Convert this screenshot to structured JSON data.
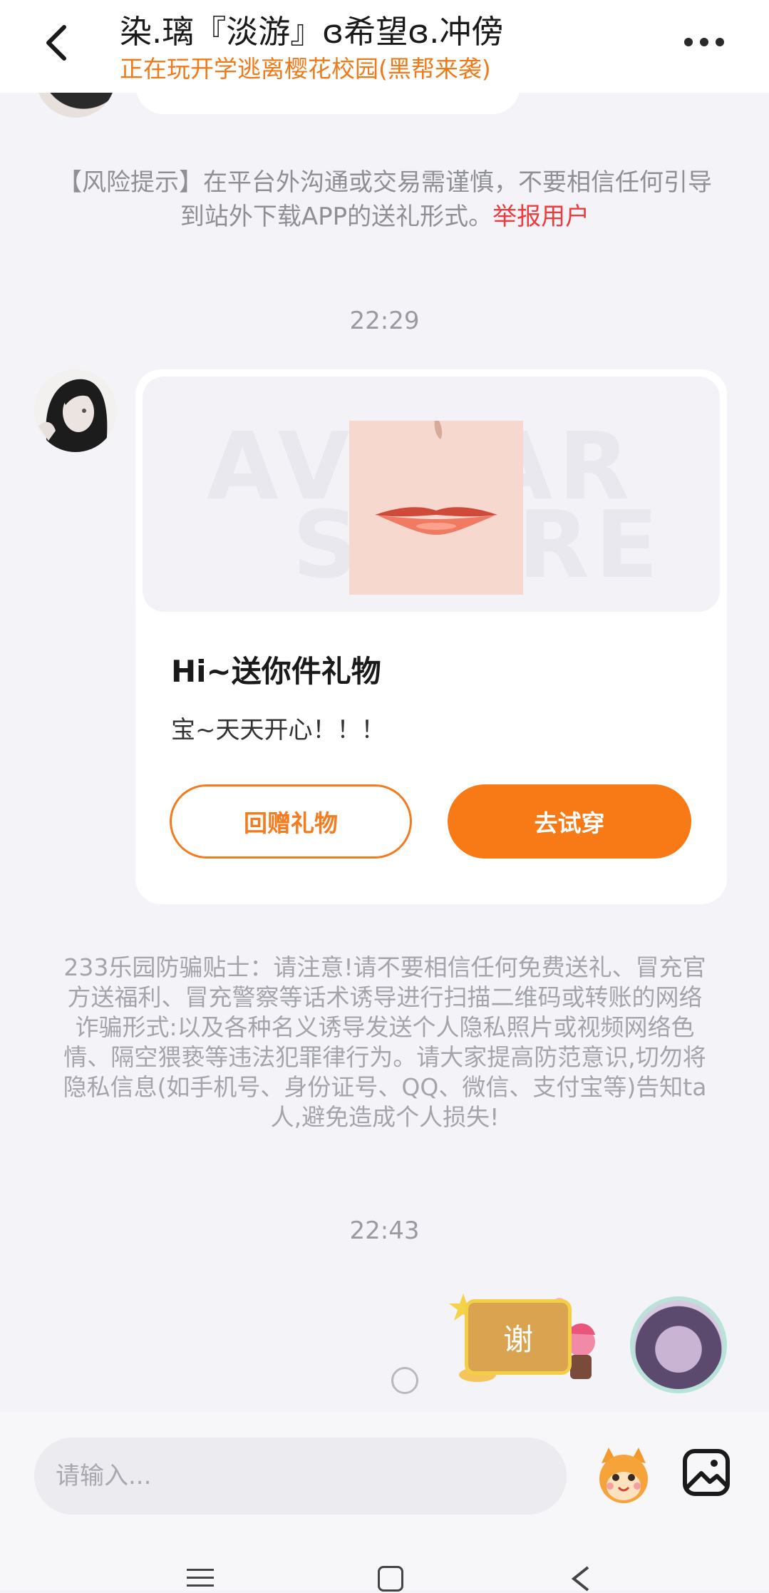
{
  "header": {
    "title": "染.璃『淡游』ɞ希望ɞ.冲傍",
    "subtitle": "正在玩开学逃离樱花校园(黑帮来袭)"
  },
  "notices": {
    "risk_text": "【风险提示】在平台外沟通或交易需谨慎，不要相信任何引导到站外下载APP的送礼形式。",
    "report_link": "举报用户",
    "anti_fraud": "233乐园防骗贴士：请注意!请不要相信任何免费送礼、冒充官方送福利、冒充警察等话术诱导进行扫描二维码或转账的网络诈骗形式:以及各种名义诱导发送个人隐私照片或视频网络色情、隔空猥亵等违法犯罪律行为。请大家提高防范意识,切勿将隐私信息(如手机号、身份证号、QQ、微信、支付宝等)告知ta人,避免造成个人损失!"
  },
  "timestamps": [
    "22:29",
    "22:43"
  ],
  "gift_card": {
    "watermark_line1": "AVATAR",
    "watermark_line2": "STORE",
    "title": "Hi~送你件礼物",
    "message": "宝~天天开心！！！",
    "return_gift_label": "回赠礼物",
    "try_on_label": "去试穿"
  },
  "sticker": {
    "text": "谢"
  },
  "input": {
    "placeholder": "请输入..."
  },
  "colors": {
    "accent": "#f77a16",
    "report": "#ef3b3b"
  },
  "icons": [
    "back-arrow-icon",
    "more-icon",
    "emoji-mascot-icon",
    "image-icon",
    "nav-menu-icon",
    "nav-home-icon",
    "nav-back-icon"
  ]
}
